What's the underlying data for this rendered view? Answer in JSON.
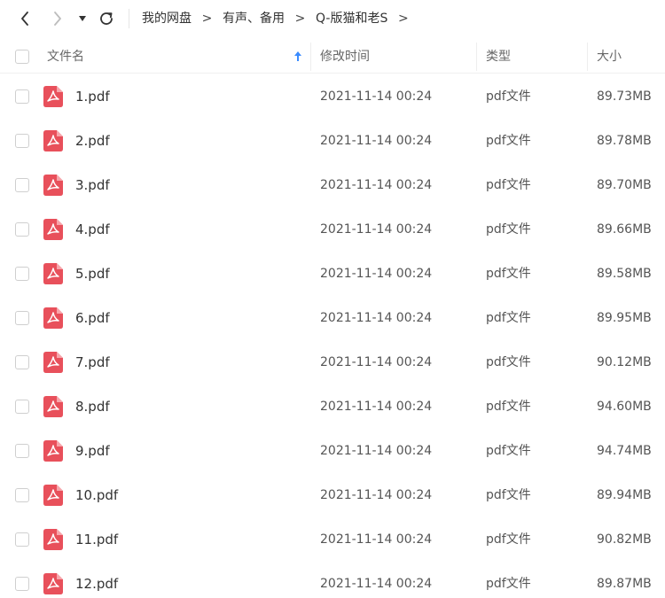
{
  "breadcrumb": {
    "items": [
      "我的网盘",
      "有声、备用",
      "Q-版猫和老S"
    ],
    "separator": ">"
  },
  "header": {
    "name": "文件名",
    "modified": "修改时间",
    "type": "类型",
    "size": "大小"
  },
  "colors": {
    "pdf_icon": "#e8505b",
    "sort_arrow": "#3b8cff"
  },
  "files": [
    {
      "name": "1.pdf",
      "modified": "2021-11-14 00:24",
      "type": "pdf文件",
      "size": "89.73MB"
    },
    {
      "name": "2.pdf",
      "modified": "2021-11-14 00:24",
      "type": "pdf文件",
      "size": "89.78MB"
    },
    {
      "name": "3.pdf",
      "modified": "2021-11-14 00:24",
      "type": "pdf文件",
      "size": "89.70MB"
    },
    {
      "name": "4.pdf",
      "modified": "2021-11-14 00:24",
      "type": "pdf文件",
      "size": "89.66MB"
    },
    {
      "name": "5.pdf",
      "modified": "2021-11-14 00:24",
      "type": "pdf文件",
      "size": "89.58MB"
    },
    {
      "name": "6.pdf",
      "modified": "2021-11-14 00:24",
      "type": "pdf文件",
      "size": "89.95MB"
    },
    {
      "name": "7.pdf",
      "modified": "2021-11-14 00:24",
      "type": "pdf文件",
      "size": "90.12MB"
    },
    {
      "name": "8.pdf",
      "modified": "2021-11-14 00:24",
      "type": "pdf文件",
      "size": "94.60MB"
    },
    {
      "name": "9.pdf",
      "modified": "2021-11-14 00:24",
      "type": "pdf文件",
      "size": "94.74MB"
    },
    {
      "name": "10.pdf",
      "modified": "2021-11-14 00:24",
      "type": "pdf文件",
      "size": "89.94MB"
    },
    {
      "name": "11.pdf",
      "modified": "2021-11-14 00:24",
      "type": "pdf文件",
      "size": "90.82MB"
    },
    {
      "name": "12.pdf",
      "modified": "2021-11-14 00:24",
      "type": "pdf文件",
      "size": "89.87MB"
    }
  ]
}
